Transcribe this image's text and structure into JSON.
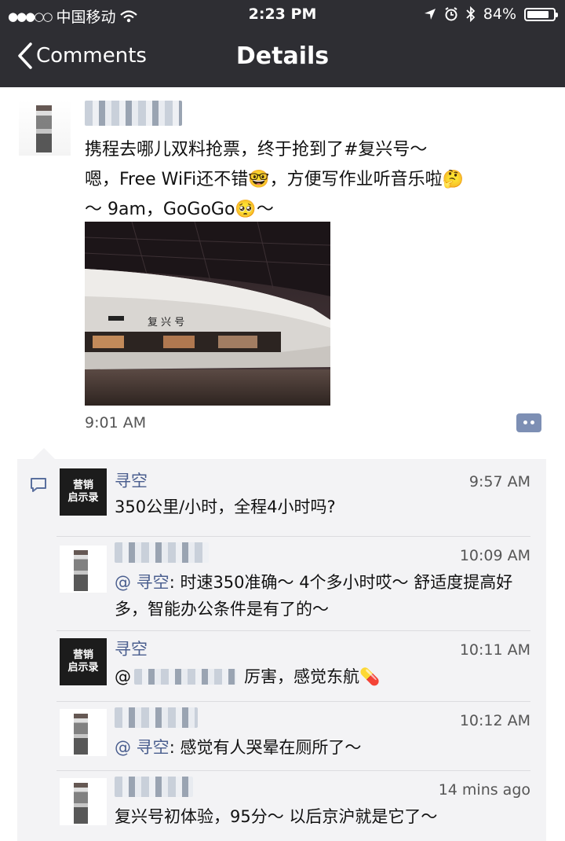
{
  "status_bar": {
    "carrier": "中国移动",
    "time": "2:23 PM",
    "battery": "84%",
    "battery_level": 0.84
  },
  "nav": {
    "back_label": "Comments",
    "title": "Details"
  },
  "post": {
    "text": "携程去哪儿双料抢票，终于抢到了#复兴号～\n嗯，Free WiFi还不错🤓，方便写作业听音乐啦🤔\n～ 9am，GoGoGo🥺～",
    "photo_sign": "复 兴 号",
    "time": "9:01 AM"
  },
  "comments": [
    {
      "avatar": "brand",
      "avatar_line1": "营销",
      "avatar_line2": "启示录",
      "name": "寻空",
      "time": "9:57 AM",
      "text": "350公里/小时，全程4小时吗?"
    },
    {
      "avatar": "person",
      "time": "10:09 AM",
      "at": "@ 寻空",
      "text": ": 时速350准确～ 4个多小时哎～ 舒适度提高好多，智能办公条件是有了的～"
    },
    {
      "avatar": "brand",
      "avatar_line1": "营销",
      "avatar_line2": "启示录",
      "name": "寻空",
      "time": "10:11 AM",
      "at": "@",
      "text": "厉害，感觉东航💊"
    },
    {
      "avatar": "person",
      "time": "10:12 AM",
      "at": "@ 寻空",
      "text": ": 感觉有人哭晕在厕所了～"
    },
    {
      "avatar": "person",
      "time": "14 mins ago",
      "text": "复兴号初体验，95分～ 以后京沪就是它了～"
    }
  ],
  "colors": {
    "bar": "#2e2e33",
    "link": "#4b5f8f",
    "comment_bg": "#f3f3f5",
    "action_button": "#7d8fb4"
  }
}
